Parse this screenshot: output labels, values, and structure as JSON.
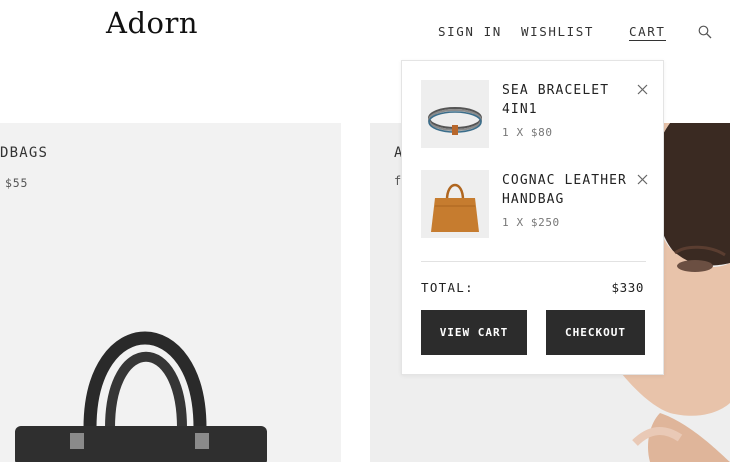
{
  "header": {
    "logo": "Adorn",
    "nav": {
      "signin": "SIGN IN",
      "wishlist": "WISHLIST",
      "cart": "CART"
    },
    "search_icon": "search-icon"
  },
  "products": {
    "left": {
      "title": "DBAGS",
      "price": "$55"
    },
    "right": {
      "title": "A",
      "subtitle": "f"
    }
  },
  "cart": {
    "items": [
      {
        "name": "SEA BRACELET 4IN1",
        "qty_price": "1 X $80",
        "thumb_icon": "bracelet-icon"
      },
      {
        "name": "COGNAC LEATHER HANDBAG",
        "qty_price": "1 X $250",
        "thumb_icon": "handbag-icon"
      }
    ],
    "total_label": "TOTAL:",
    "total_value": "$330",
    "view_cart_label": "VIEW CART",
    "checkout_label": "CHECKOUT"
  },
  "colors": {
    "button_bg": "#2c2c2c",
    "panel_bg": "#f2f2f2",
    "handbag": "#c67c2f"
  }
}
